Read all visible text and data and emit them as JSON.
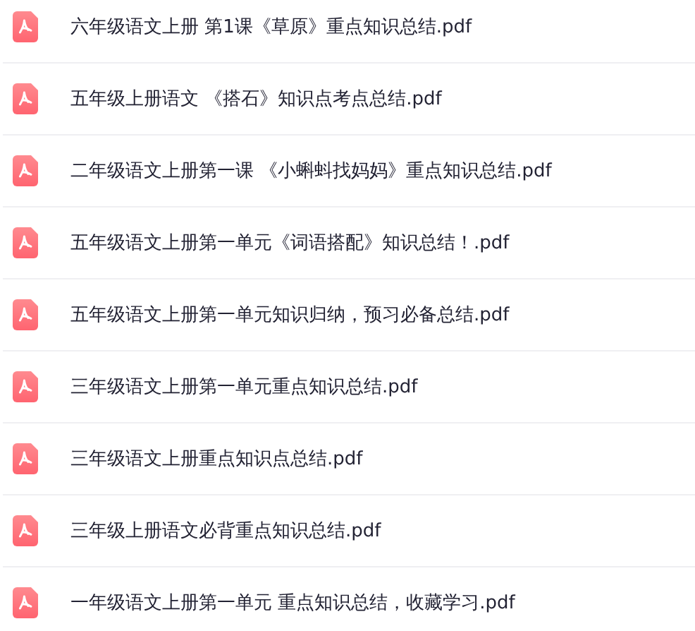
{
  "files": [
    {
      "name": "六年级语文上册 第1课《草原》重点知识总结.pdf"
    },
    {
      "name": "五年级上册语文 《搭石》知识点考点总结.pdf"
    },
    {
      "name": "二年级语文上册第一课 《小蝌蚪找妈妈》重点知识总结.pdf"
    },
    {
      "name": "五年级语文上册第一单元《词语搭配》知识总结！.pdf"
    },
    {
      "name": "五年级语文上册第一单元知识归纳，预习必备总结.pdf"
    },
    {
      "name": "三年级语文上册第一单元重点知识总结.pdf"
    },
    {
      "name": "三年级语文上册重点知识点总结.pdf"
    },
    {
      "name": "三年级上册语文必背重点知识总结.pdf"
    },
    {
      "name": "一年级语文上册第一单元 重点知识总结，收藏学习.pdf"
    }
  ]
}
